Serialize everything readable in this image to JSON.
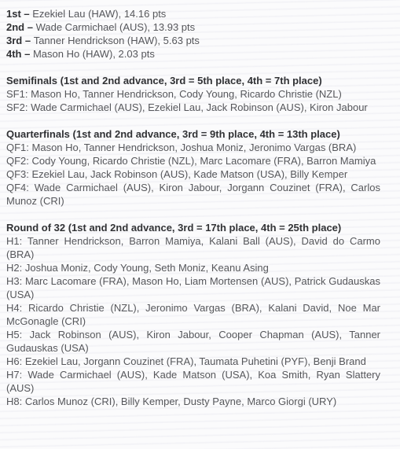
{
  "results": {
    "placings": [
      {
        "rank": "1st",
        "dash": " – ",
        "detail": "Ezekiel Lau (HAW), 14.16 pts"
      },
      {
        "rank": "2nd",
        "dash": " – ",
        "detail": "Wade Carmichael (AUS), 13.93 pts"
      },
      {
        "rank": "3rd",
        "dash": " – ",
        "detail": "Tanner Hendrickson (HAW), 5.63 pts"
      },
      {
        "rank": "4th",
        "dash": " – ",
        "detail": "Mason Ho (HAW), 2.03 pts"
      }
    ]
  },
  "semifinals": {
    "heading": "Semifinals (1st and 2nd advance, 3rd = 5th place, 4th = 7th place)",
    "heats": [
      "SF1: Mason Ho, Tanner Hendrickson, Cody Young, Ricardo Christie (NZL)",
      "SF2: Wade Carmichael (AUS), Ezekiel Lau, Jack Robinson (AUS), Kiron Jabour"
    ]
  },
  "quarterfinals": {
    "heading": "Quarterfinals (1st and 2nd advance, 3rd = 9th place, 4th = 13th place)",
    "heats": [
      "QF1: Mason Ho, Tanner Hendrickson, Joshua Moniz, Jeronimo Vargas (BRA)",
      "QF2: Cody Young, Ricardo Christie (NZL), Marc Lacomare (FRA), Barron Mamiya",
      "QF3: Ezekiel Lau, Jack Robinson (AUS), Kade Matson (USA), Billy Kemper",
      "QF4: Wade Carmichael (AUS), Kiron Jabour, Jorgann Couzinet (FRA), Carlos Munoz (CRI)"
    ]
  },
  "round_of_32": {
    "heading": "Round of 32 (1st and 2nd advance, 3rd = 17th place, 4th = 25th place)",
    "heats": [
      "H1: Tanner Hendrickson, Barron Mamiya, Kalani Ball (AUS), David do Carmo (BRA)",
      "H2: Joshua Moniz, Cody Young, Seth Moniz, Keanu Asing",
      "H3: Marc Lacomare (FRA), Mason Ho, Liam Mortensen (AUS), Patrick Gudauskas (USA)",
      "H4: Ricardo Christie (NZL), Jeronimo Vargas (BRA), Kalani David, Noe Mar McGonagle (CRI)",
      "H5: Jack Robinson (AUS), Kiron Jabour, Cooper Chapman (AUS), Tanner Gudauskas (USA)",
      "H6: Ezekiel Lau, Jorgann Couzinet (FRA), Taumata Puhetini (PYF), Benji Brand",
      "H7: Wade Carmichael (AUS), Kade Matson (USA), Koa Smith, Ryan Slattery (AUS)",
      "H8: Carlos Munoz (CRI), Billy Kemper, Dusty Payne, Marco Giorgi (URY)"
    ]
  }
}
